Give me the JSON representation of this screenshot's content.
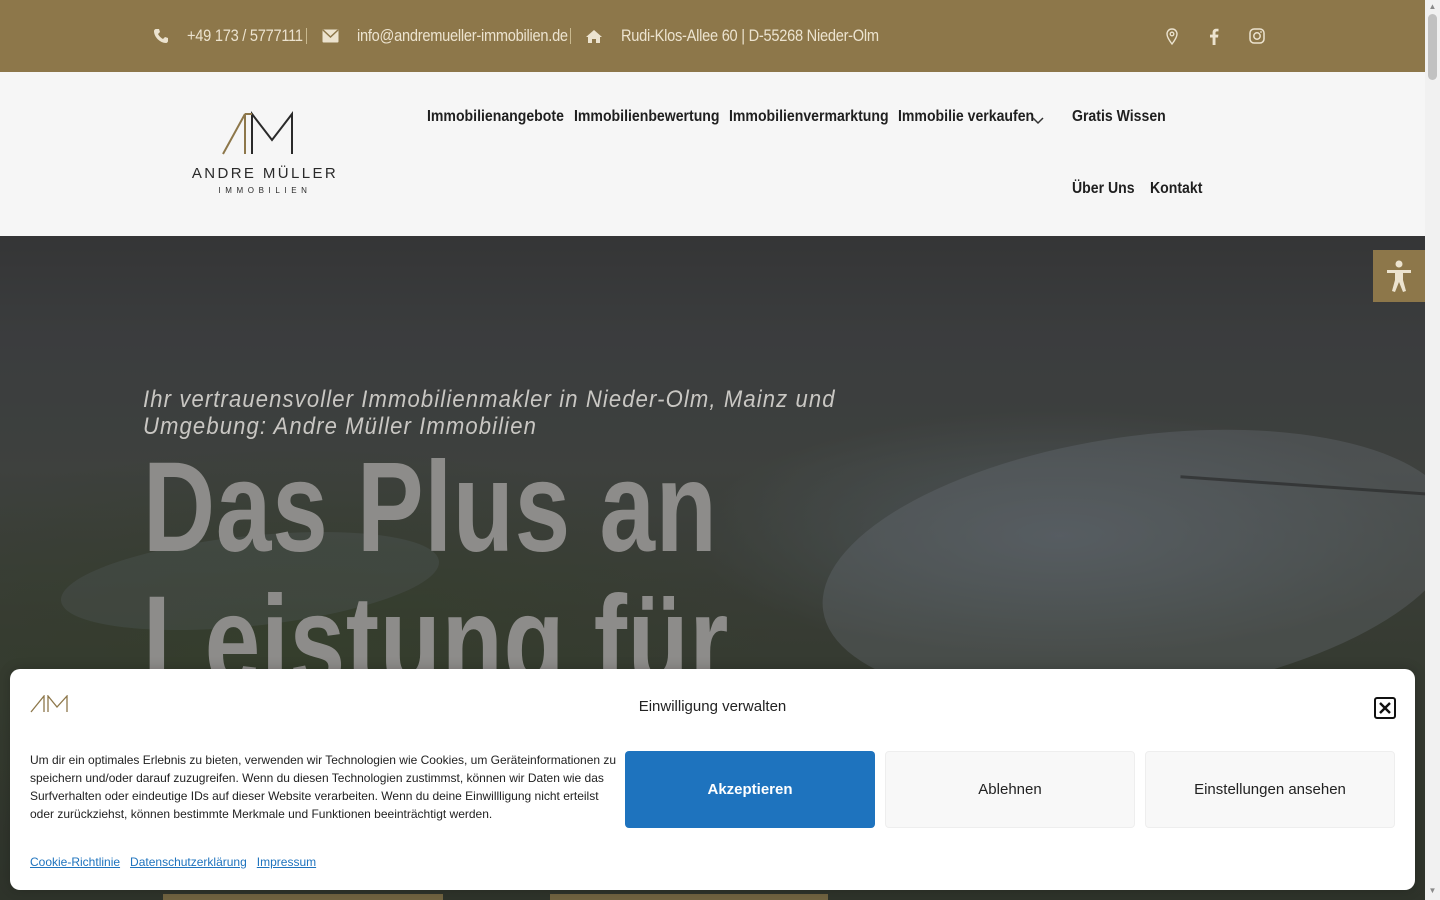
{
  "topbar": {
    "phone": "+49 173 / 5777111",
    "email": "info@andremueller-immobilien.de",
    "address": "Rudi-Klos-Allee 60 | D-55268 Nieder-Olm",
    "icons": [
      "phone-icon",
      "envelope-icon",
      "home-icon",
      "map-pin-icon",
      "facebook-icon",
      "instagram-icon"
    ]
  },
  "logo": {
    "monogram": "AM",
    "brand": "ANDRE MÜLLER",
    "sub": "IMMOBILIEN"
  },
  "nav": {
    "items": [
      {
        "label": "Immobilienangebote"
      },
      {
        "label": "Immobilienbewertung"
      },
      {
        "label": "Immobilienvermarktung"
      },
      {
        "label": "Immobilie verkaufen"
      },
      {
        "label": "Gratis Wissen"
      },
      {
        "label": "Über Uns"
      },
      {
        "label": "Kontakt"
      }
    ]
  },
  "hero": {
    "tagline": "Ihr vertrauensvoller Immobilienmakler in Nieder-Olm, Mainz und Umgebung: Andre Müller Immobilien",
    "headline": "Das Plus an Leistung für"
  },
  "consent": {
    "title": "Einwilligung verwalten",
    "message": "Um dir ein optimales Erlebnis zu bieten, verwenden wir Technologien wie Cookies, um Geräteinformationen zu speichern und/oder darauf zuzugreifen. Wenn du diesen Technologien zustimmst, können wir Daten wie das Surfverhalten oder eindeutige IDs auf dieser Website verarbeiten. Wenn du deine Einwillligung nicht erteilst oder zurückziehst, können bestimmte Merkmale und Funktionen beeinträchtigt werden.",
    "accept": "Akzeptieren",
    "deny": "Ablehnen",
    "preferences": "Einstellungen ansehen",
    "links": [
      "Cookie-Richtlinie",
      "Datenschutzerklärung",
      "Impressum"
    ]
  },
  "colors": {
    "brand_gold": "#8d774a",
    "accept_blue": "#1e73be"
  }
}
